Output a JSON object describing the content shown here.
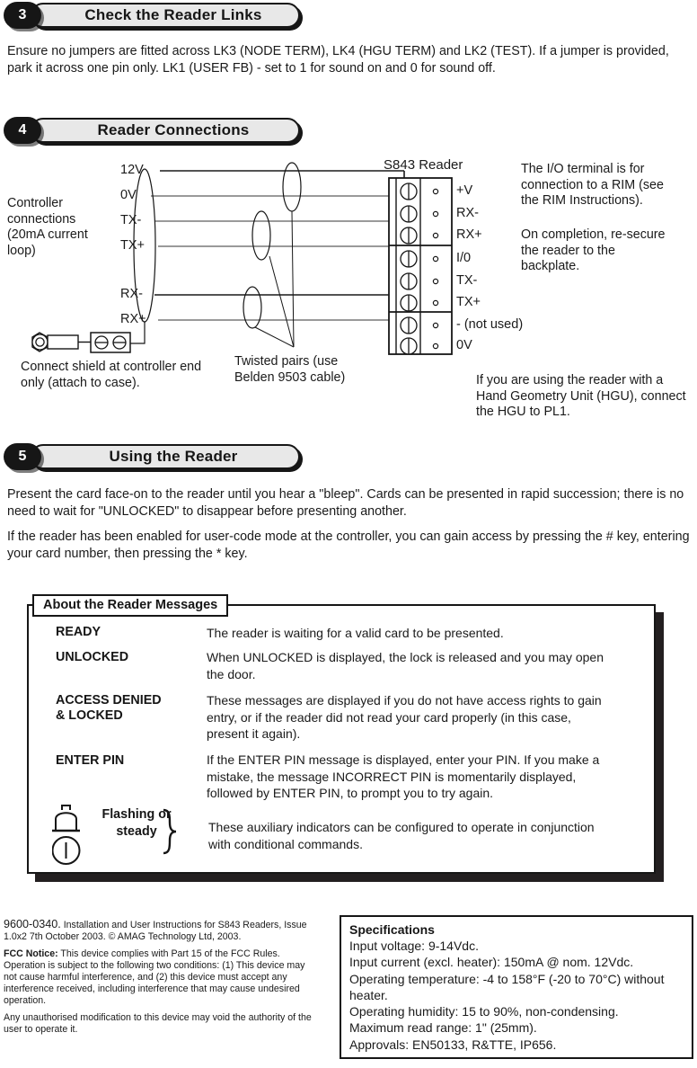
{
  "steps": [
    {
      "number": "3",
      "title": "Check the Reader Links"
    },
    {
      "number": "4",
      "title": "Reader Connections"
    },
    {
      "number": "5",
      "title": "Using the Reader"
    }
  ],
  "step3": {
    "paragraph": "Ensure no jumpers are fitted across LK3 (NODE TERM), LK4 (HGU TERM) and LK2 (TEST). If a jumper is provided, park it across one pin only. LK1 (USER FB) - set to 1 for sound on and 0 for sound off."
  },
  "diagram": {
    "controller_caption": "Controller connections (20mA current loop)",
    "controller_terminals": [
      "12V",
      "0V",
      "TX-",
      "TX+",
      "RX-",
      "RX+"
    ],
    "reader_title": "S843 Reader",
    "reader_terminals": [
      "+V",
      "RX-",
      "RX+",
      "I/0",
      "TX-",
      "TX+",
      "- (not used)",
      "0V"
    ],
    "shield_note": "Connect shield at controller end only (attach to case).",
    "twisted_note": "Twisted pairs (use Belden 9503 cable)",
    "io_note": "The I/O terminal is for connection to a RIM (see the RIM Instructions).",
    "resecure_note": "On completion, re-secure the reader to the backplate.",
    "hgu_note": "If you are using the reader with a Hand Geometry Unit (HGU), connect the HGU to PL1."
  },
  "step5": {
    "paragraph1": "Present the card face-on to the reader until you hear a \"bleep\". Cards can be presented in rapid succession; there is no need to wait for \"UNLOCKED\" to disappear before presenting another.",
    "paragraph2": "If the reader has been enabled for user-code mode at the controller, you can gain access by pressing the # key, entering your card number, then pressing the * key."
  },
  "messages_box": {
    "title": "About the Reader Messages",
    "rows": [
      {
        "term": "READY",
        "description": "The reader is waiting for a valid card to be presented."
      },
      {
        "term": "UNLOCKED",
        "description": "When UNLOCKED is displayed, the lock is released and you may open the door."
      },
      {
        "term": "ACCESS DENIED\n& LOCKED",
        "description": "These messages are displayed if you do not have access rights to gain entry, or if the reader did not read your card properly (in this case, present it again)."
      },
      {
        "term": "ENTER PIN",
        "description": "If the ENTER PIN message is displayed, enter your PIN. If you make a mistake, the message INCORRECT PIN is momentarily displayed, followed by ENTER PIN, to prompt you to try again."
      }
    ],
    "indicator_label": "Flashing or steady",
    "indicator_description": "These auxiliary indicators can be configured to operate in conjunction with conditional commands."
  },
  "footer": {
    "doc_code": "9600-0340.",
    "doc_info": "Installation and User Instructions for S843 Readers, Issue 1.0x2 7th October 2003. © AMAG Technology Ltd, 2003.",
    "fcc_label": "FCC Notice:",
    "fcc_text": "This device complies with Part 15 of the FCC Rules. Operation is subject to the following two conditions: (1) This device may not cause harmful interference, and (2) this device must accept any interference received, including interference that may cause undesired operation.",
    "modification_text": "Any unauthorised modification to this device may void the authority of the user to operate it."
  },
  "specifications": {
    "title": "Specifications",
    "lines": [
      "Input voltage: 9-14Vdc.",
      "Input current (excl. heater): 150mA @ nom. 12Vdc.",
      "Operating temperature: -4 to 158°F (-20 to 70°C) without heater.",
      "Operating humidity: 15 to 90%, non-condensing.",
      "Maximum read range: 1\" (25mm).",
      "Approvals: EN50133, R&TTE, IP656."
    ]
  },
  "colors": {
    "ink": "#161616",
    "bar_fill": "#e8e8e8",
    "wire_grey": "#9a9a9a",
    "wire_black": "#1a1a1a"
  }
}
